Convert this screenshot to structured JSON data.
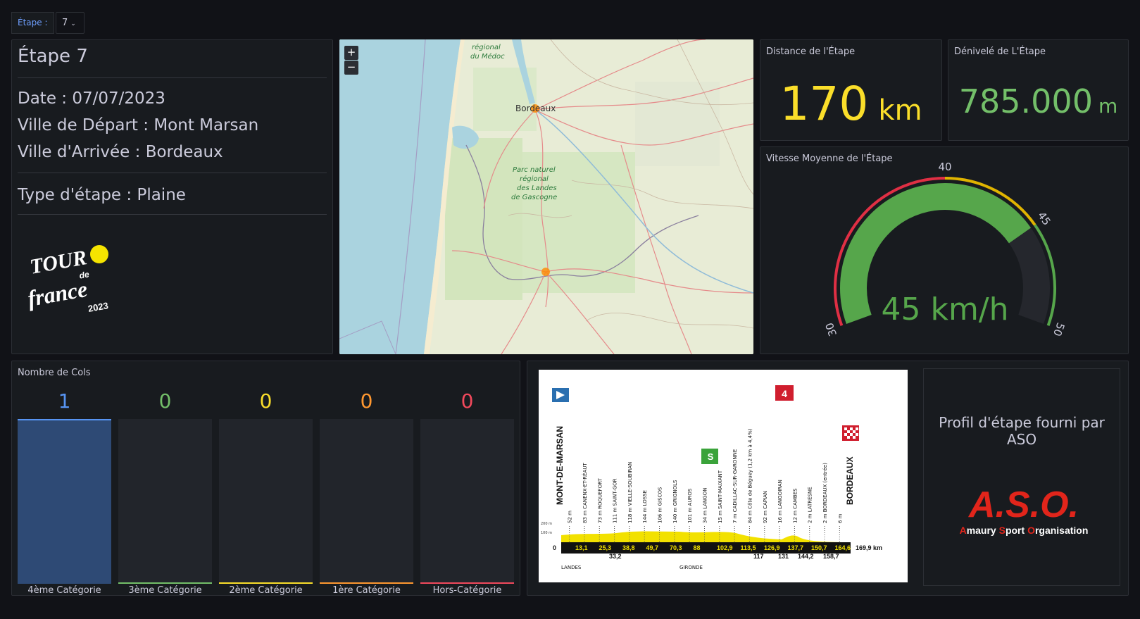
{
  "variable": {
    "label": "Étape :",
    "value": "7"
  },
  "stage_panel": {
    "title": "Étape 7",
    "date": "Date : 07/07/2023",
    "start": "Ville de Départ : Mont Marsan",
    "finish": "Ville d'Arrivée : Bordeaux",
    "type": "Type d'étape : Plaine",
    "logo_text": [
      "TOUR",
      "de",
      "france",
      "2023"
    ]
  },
  "map": {
    "zoom_in": "+",
    "zoom_out": "−",
    "labels": {
      "city": "Bordeaux",
      "park_medoc": [
        "régional",
        "du Médoc"
      ],
      "park_landes": [
        "Parc naturel",
        "régional",
        "des Landes",
        "de Gascogne"
      ]
    }
  },
  "distance": {
    "title": "Distance de l'Étape",
    "value": "170",
    "unit": "km",
    "color": "#fade2a"
  },
  "elevation": {
    "title": "Dénivelé de L'Étape",
    "value": "785.000",
    "unit": "m",
    "color": "#73bf69"
  },
  "speed": {
    "title": "Vitesse Moyenne de l'Étape",
    "value": "45 km/h",
    "gauge_value": 45,
    "min": 30,
    "max": 50,
    "ticks": [
      "30",
      "40",
      "45",
      "50"
    ],
    "color": "#56a64b"
  },
  "cols": {
    "title": "Nombre de Cols",
    "bars": [
      {
        "label": "4ème Catégorie",
        "value": "1",
        "color": "#5794f2"
      },
      {
        "label": "3ème Catégorie",
        "value": "0",
        "color": "#73bf69"
      },
      {
        "label": "2ème Catégorie",
        "value": "0",
        "color": "#fade2a"
      },
      {
        "label": "1ère Catégorie",
        "value": "0",
        "color": "#ff9830"
      },
      {
        "label": "Hors-Catégorie",
        "value": "0",
        "color": "#f2495c"
      }
    ]
  },
  "profile": {
    "start_city": "MONT-DE-MARSAN",
    "finish_city": "BORDEAUX",
    "total": "169,9 km",
    "zero": "0",
    "waypoints": [
      "52 m",
      "83 m CANENX-ET-RÉAUT",
      "73 m ROQUEFORT",
      "111 m SAINT-GOR",
      "118 m VIELLE-SOUBIRAN",
      "144 m LOSSE",
      "106 m GISCOS",
      "140 m GRIGNOLS",
      "101 m AUROS",
      "34 m LANGON",
      "15 m SAINT-MAIXANT",
      "7 m CADILLAC-SUR-GARONNE",
      "84 m Côte de Béguey (1,2 km à 4,4%)",
      "92 m CAPIAN",
      "16 m LANGOIRAN",
      "12 m CAMBES",
      "2 m LATRESNE",
      "2 m BORDEAUX (entrée)",
      "6 m"
    ],
    "km_top": [
      "13,1",
      "25,3",
      "38,8",
      "49,7",
      "70,3",
      "88",
      "102,9",
      "113,5",
      "126,9",
      "137,7",
      "150,7",
      "164,6"
    ],
    "km_bottom": [
      "33,2",
      "117",
      "131",
      "144,2",
      "158,7"
    ],
    "scale": [
      "200 m",
      "100 m"
    ],
    "regions": [
      "LANDES",
      "GIRONDE"
    ],
    "badges": [
      "4",
      "S"
    ]
  },
  "aso": {
    "text": "Profil d'étape fourni par ASO",
    "logo": "A.S.O.",
    "tagline": [
      "A",
      "maury ",
      "S",
      "port ",
      "O",
      "rganisation"
    ]
  }
}
